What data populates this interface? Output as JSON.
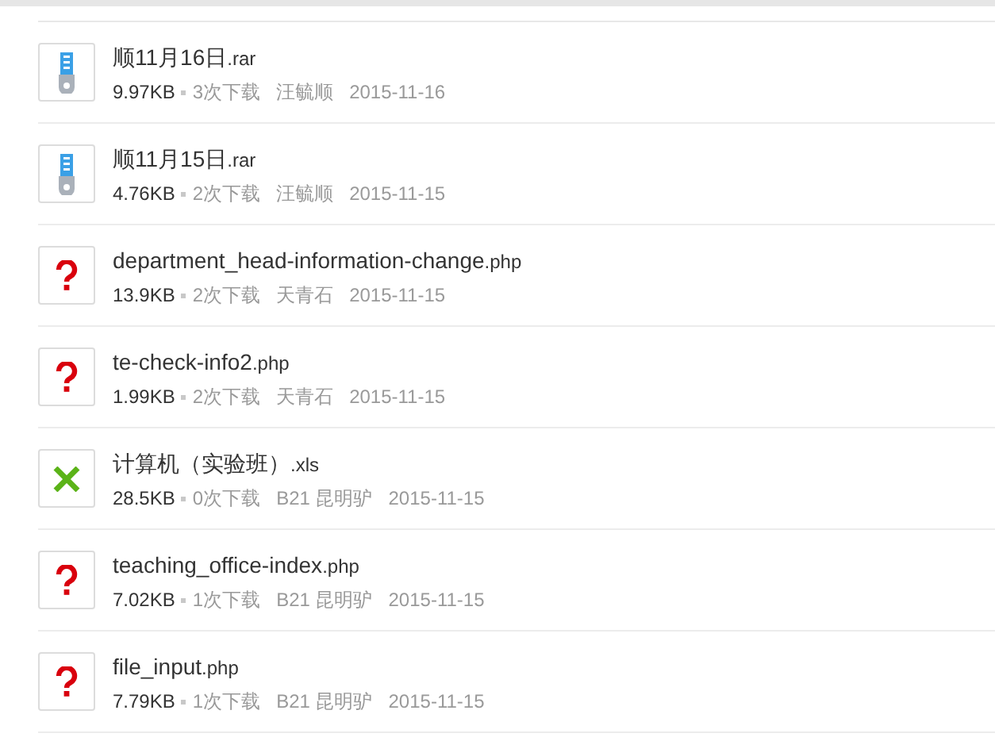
{
  "files": [
    {
      "kind": "archive",
      "name": "顺11月16日",
      "ext": ".rar",
      "size": "9.97KB",
      "downloads": "3次下载",
      "uploader": "汪毓顺",
      "date": "2015-11-16"
    },
    {
      "kind": "archive",
      "name": "顺11月15日",
      "ext": ".rar",
      "size": "4.76KB",
      "downloads": "2次下载",
      "uploader": "汪毓顺",
      "date": "2015-11-15"
    },
    {
      "kind": "unknown",
      "name": "department_head-information-change",
      "ext": ".php",
      "size": "13.9KB",
      "downloads": "2次下载",
      "uploader": "天青石",
      "date": "2015-11-15"
    },
    {
      "kind": "unknown",
      "name": "te-check-info2",
      "ext": ".php",
      "size": "1.99KB",
      "downloads": "2次下载",
      "uploader": "天青石",
      "date": "2015-11-15"
    },
    {
      "kind": "spreadsheet",
      "name": "计算机（实验班）",
      "ext": ".xls",
      "size": "28.5KB",
      "downloads": "0次下载",
      "uploader": "B21 昆明驴",
      "date": "2015-11-15"
    },
    {
      "kind": "unknown",
      "name": "teaching_office-index",
      "ext": ".php",
      "size": "7.02KB",
      "downloads": "1次下载",
      "uploader": "B21 昆明驴",
      "date": "2015-11-15"
    },
    {
      "kind": "unknown",
      "name": "file_input",
      "ext": ".php",
      "size": "7.79KB",
      "downloads": "1次下载",
      "uploader": "B21 昆明驴",
      "date": "2015-11-15"
    }
  ]
}
